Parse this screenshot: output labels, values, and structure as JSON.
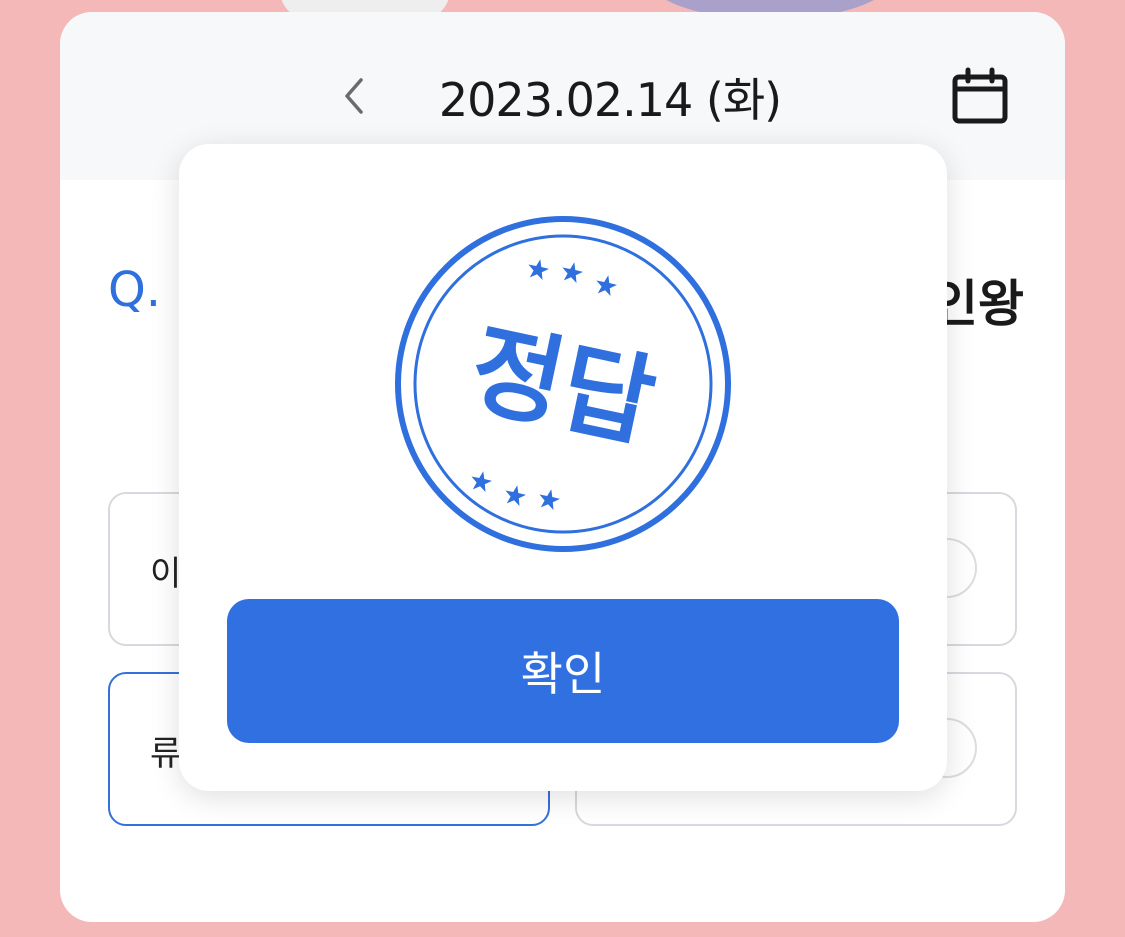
{
  "header": {
    "date": "2023.02.14 (화)",
    "prev_icon": "chevron-left-icon",
    "calendar_icon": "calendar-icon"
  },
  "question": {
    "prefix": "Q.",
    "visible_tail": "인왕"
  },
  "options": [
    {
      "label": "이",
      "selected": false
    },
    {
      "label": "",
      "selected": false
    },
    {
      "label": "류",
      "selected": true
    },
    {
      "label": "",
      "selected": false
    }
  ],
  "modal": {
    "stamp_text": "정답",
    "stamp_icon": "correct-answer-stamp-icon",
    "confirm_label": "확인"
  },
  "colors": {
    "background": "#f4b8b8",
    "accent": "#3170e0",
    "stamp": "#2f6fde"
  }
}
